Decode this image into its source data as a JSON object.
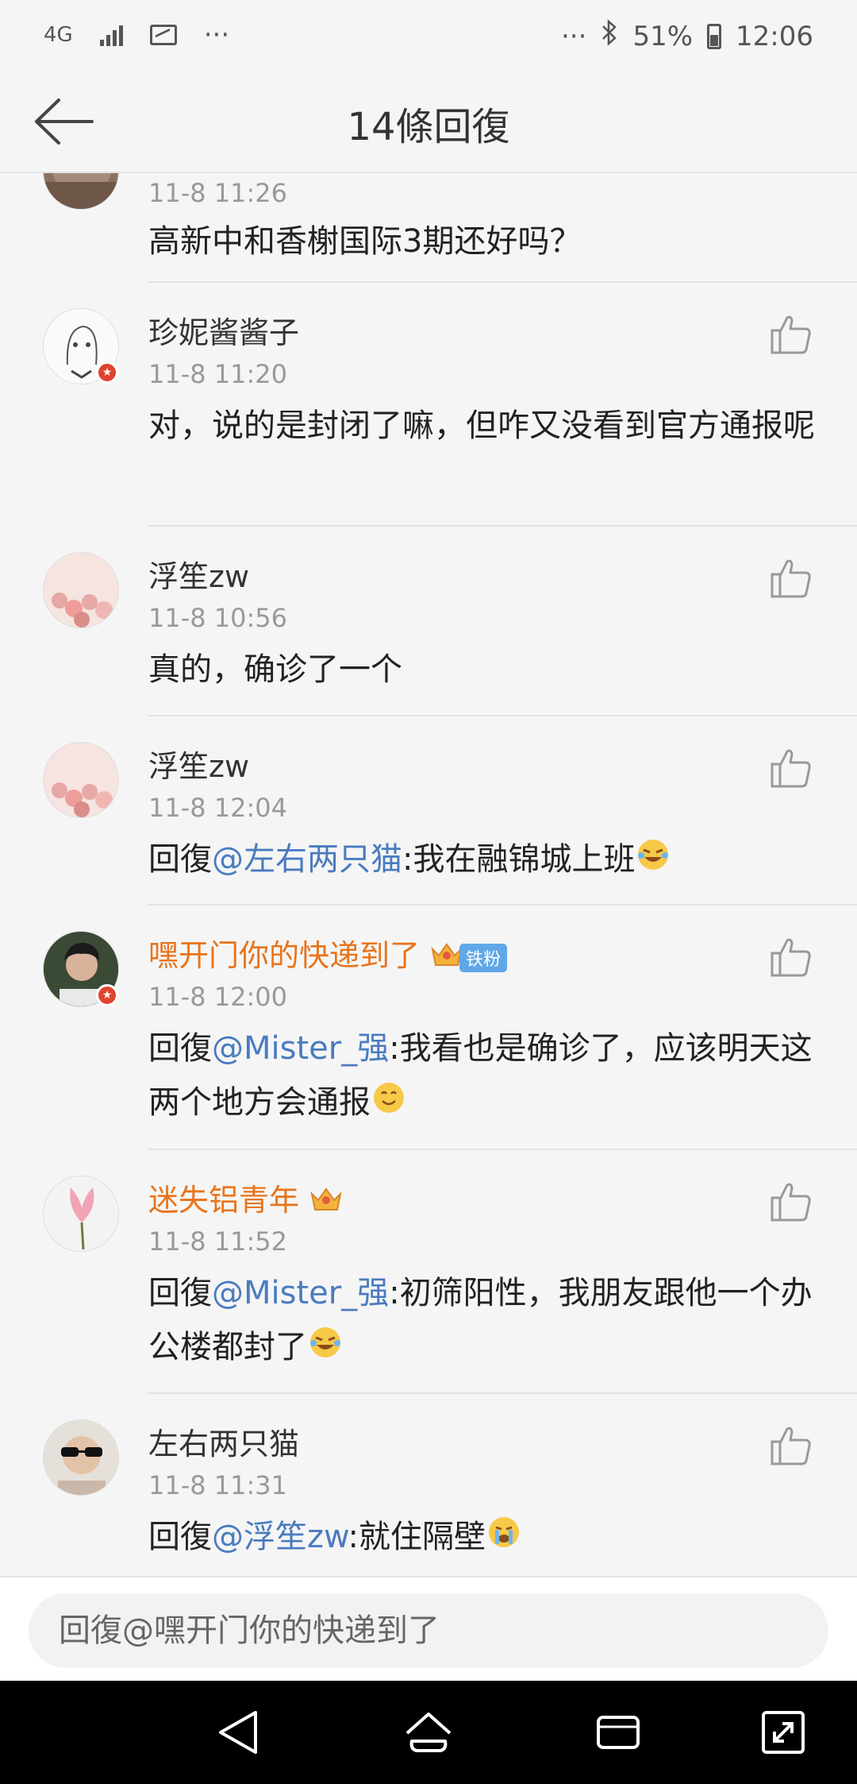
{
  "status_bar": {
    "network": "4G",
    "dots": "···",
    "right_dots": "···",
    "battery": "51%",
    "time": "12:06"
  },
  "header": {
    "title": "14條回復"
  },
  "comments": [
    {
      "time": "11-8 11:26",
      "text": "高新中和香榭国际3期还好吗？"
    },
    {
      "name": "珍妮酱酱子",
      "time": "11-8 11:20",
      "text": "对，说的是封闭了嘛，但咋又没看到官方通报呢"
    },
    {
      "name": "浮笙zw",
      "time": "11-8 10:56",
      "text": "真的，确诊了一个"
    },
    {
      "name": "浮笙zw",
      "time": "11-8 12:04",
      "prefix": "回復",
      "mention": "@左右两只猫",
      "text": ":我在融锦城上班"
    },
    {
      "name": "嘿开门你的快递到了",
      "fan_badge": "铁粉",
      "time": "11-8 12:00",
      "prefix": "回復",
      "mention": "@Mister_强",
      "text": ":我看也是确诊了，应该明天这两个地方会通报"
    },
    {
      "name": "迷失铝青年",
      "time": "11-8 11:52",
      "prefix": "回復",
      "mention": "@Mister_强",
      "text": ":初筛阳性，我朋友跟他一个办公楼都封了"
    },
    {
      "name": "左右两只猫",
      "time": "11-8 11:31",
      "prefix": "回復",
      "mention": "@浮笙zw",
      "text": ":就住隔壁"
    }
  ],
  "reply": {
    "placeholder": "回復@嘿开门你的快递到了"
  },
  "colors": {
    "mention": "#4a7bbf",
    "vip_name": "#e8741c",
    "background": "#f5f5f5"
  }
}
